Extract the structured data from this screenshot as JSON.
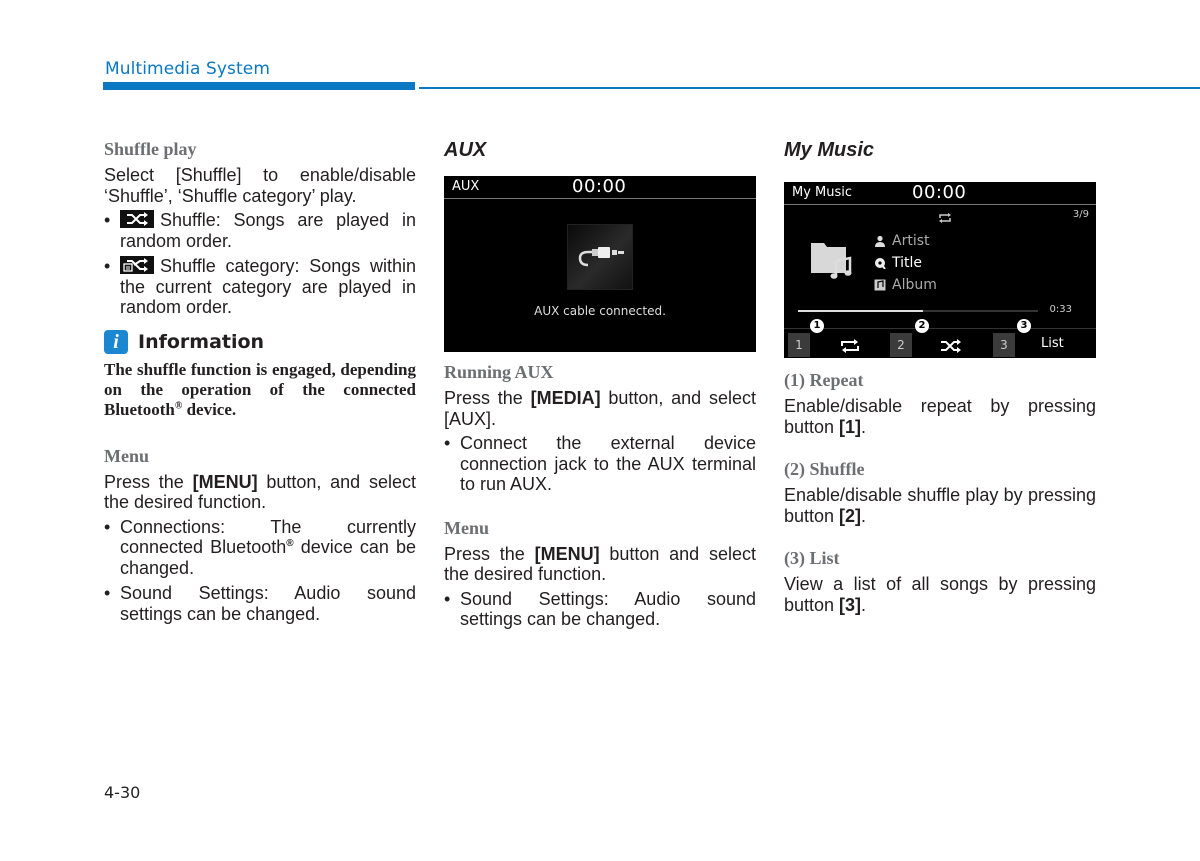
{
  "header": {
    "section_title": "Multimedia System",
    "accent_color": "#0a78c3"
  },
  "col1": {
    "shuffle_play": {
      "heading": "Shuffle play",
      "intro": "Select [Shuffle] to enable/disable ‘Shuffle’, ‘Shuffle category’ play.",
      "bullets": [
        {
          "icon": "shuffle-icon",
          "text": "Shuffle: Songs are played in random order."
        },
        {
          "icon": "shuffle-category-icon",
          "text": "Shuffle category: Songs within the current category are played in random order."
        }
      ]
    },
    "information": {
      "icon": "i",
      "title": "Information",
      "text_before": "The shuffle function is engaged, depending on the operation of the connected Bluetooth",
      "reg": "®",
      "text_after": " device."
    },
    "menu": {
      "heading": "Menu",
      "intro_pre": "Press the ",
      "intro_bold": "[MENU]",
      "intro_post": " button, and select the desired function.",
      "bullet1_pre": "Connections: The currently connected Bluetooth",
      "bullet1_reg": "®",
      "bullet1_post": " device can be changed.",
      "bullet2": "Sound Settings: Audio sound settings can be changed."
    }
  },
  "col2": {
    "heading": "AUX",
    "screen": {
      "label": "AUX",
      "clock": "00:00",
      "message": "AUX cable connected."
    },
    "running": {
      "heading": "Running AUX",
      "intro_pre": "Press the ",
      "intro_bold": "[MEDIA]",
      "intro_post": " button, and select [AUX].",
      "bullet": "Connect the external device connection jack to the AUX terminal to run AUX."
    },
    "menu": {
      "heading": "Menu",
      "intro_pre": "Press the ",
      "intro_bold": "[MENU]",
      "intro_post": " button and select the desired function.",
      "bullet": "Sound Settings: Audio sound settings can be changed."
    }
  },
  "col3": {
    "heading": "My Music",
    "screen": {
      "label": "My Music",
      "clock": "00:00",
      "track_count": "3/9",
      "artist": "Artist",
      "title": "Title",
      "album": "Album",
      "elapsed": "0:33",
      "progress_fraction": 0.52,
      "buttons": [
        {
          "num": "1",
          "badge": "1",
          "function": "repeat-icon"
        },
        {
          "num": "2",
          "badge": "2",
          "function": "shuffle-icon"
        },
        {
          "num": "3",
          "badge": "3",
          "function": "List"
        }
      ]
    },
    "items": [
      {
        "heading": "(1) Repeat",
        "pre": "Enable/disable repeat by pressing button ",
        "bold": "[1]",
        "post": "."
      },
      {
        "heading": "(2) Shuffle",
        "pre": "Enable/disable shuffle play by pressing button ",
        "bold": "[2]",
        "post": "."
      },
      {
        "heading": "(3) List",
        "pre": "View a list of all songs by pressing button ",
        "bold": "[3]",
        "post": "."
      }
    ]
  },
  "footer": {
    "page_number": "4-30"
  }
}
